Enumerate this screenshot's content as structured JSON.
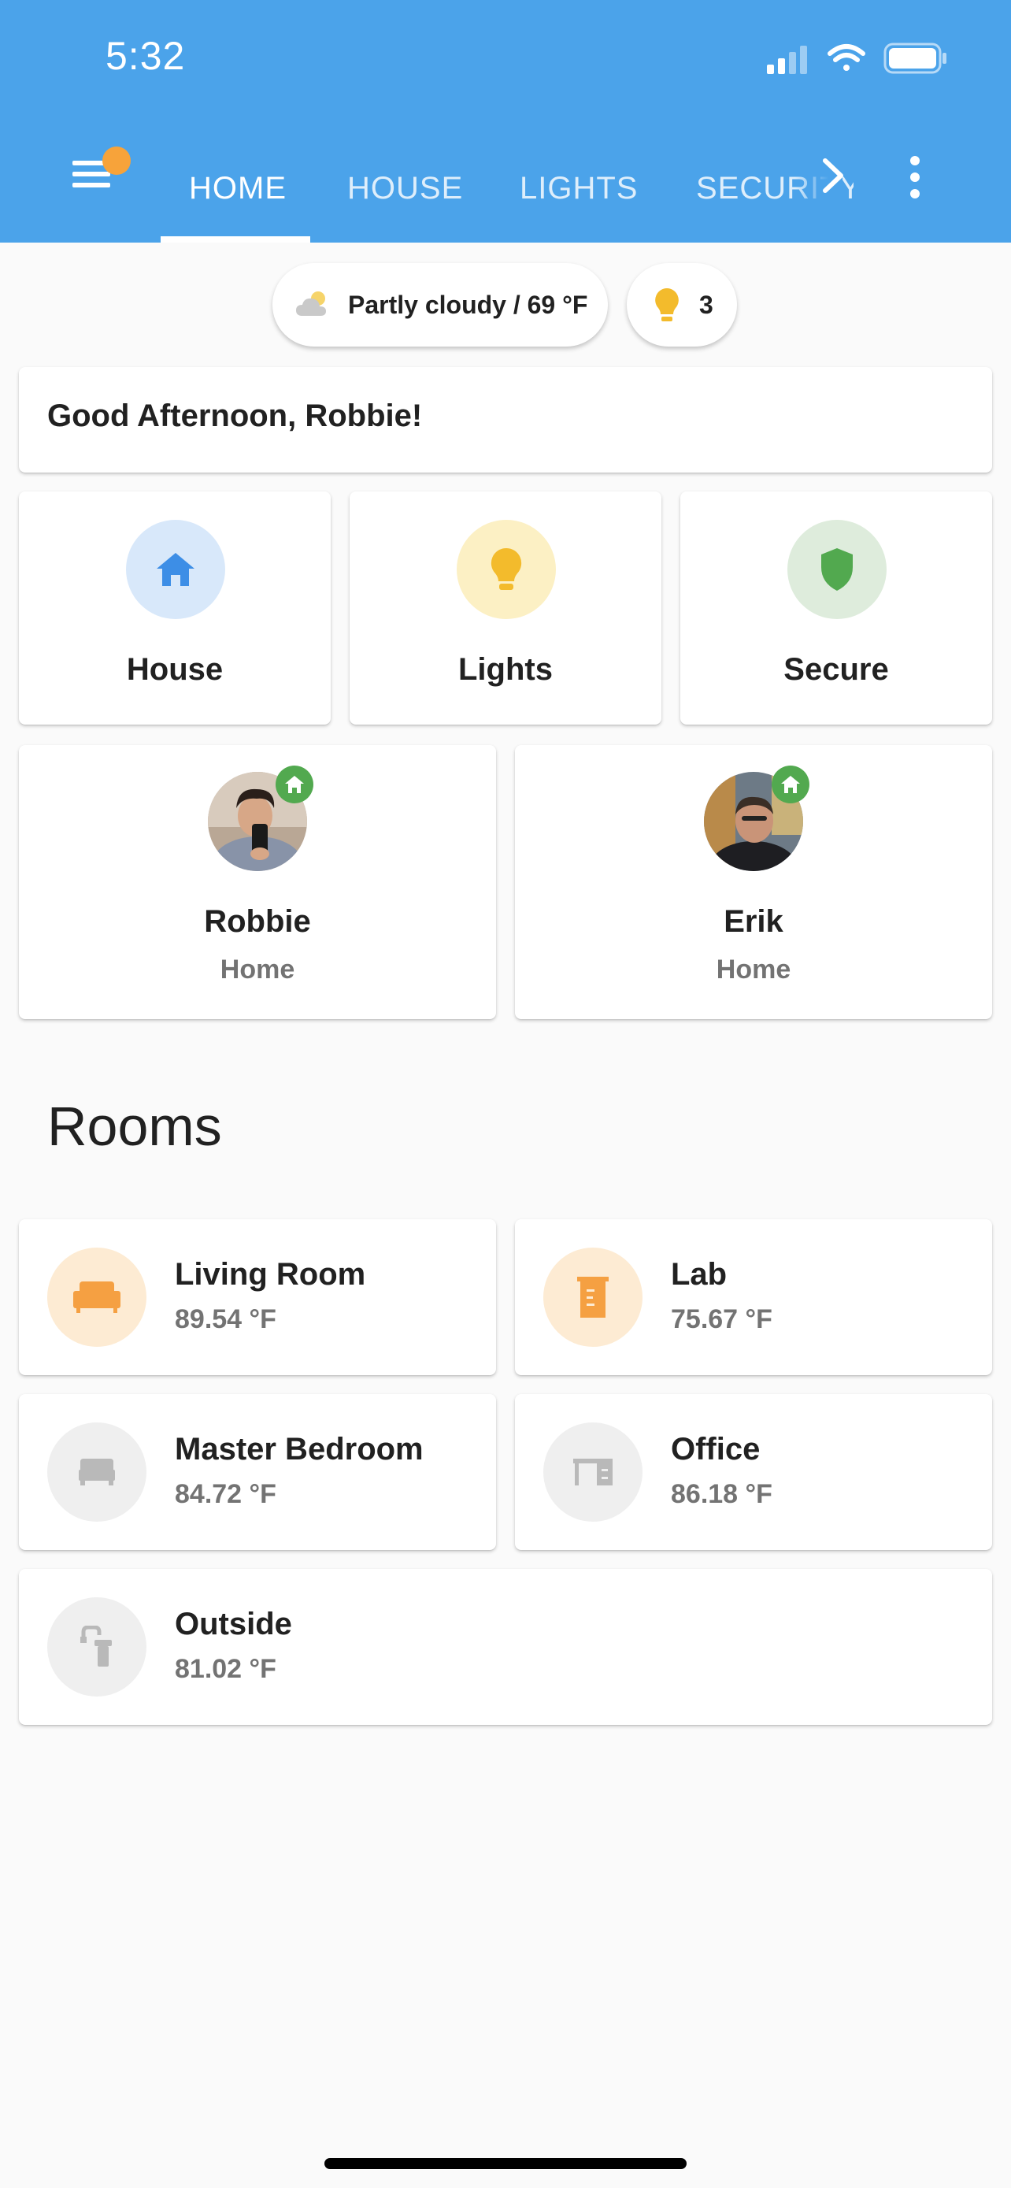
{
  "status_bar": {
    "time": "5:32"
  },
  "tabs": [
    {
      "label": "HOME",
      "active": true
    },
    {
      "label": "HOUSE",
      "active": false
    },
    {
      "label": "LIGHTS",
      "active": false
    },
    {
      "label": "SECURITY",
      "active": false
    }
  ],
  "badges": {
    "weather": {
      "icon": "partly-cloudy-icon",
      "text": "Partly cloudy / 69 °F"
    },
    "lights": {
      "icon": "lightbulb-icon",
      "count": "3"
    }
  },
  "greeting": "Good Afternoon, Robbie!",
  "areas": [
    {
      "label": "House",
      "icon": "home-icon",
      "circle_color": "#d8e8fa",
      "icon_color": "#3d8ee6"
    },
    {
      "label": "Lights",
      "icon": "lightbulb-icon",
      "circle_color": "#fcf0c4",
      "icon_color": "#f3bb2c"
    },
    {
      "label": "Secure",
      "icon": "shield-icon",
      "circle_color": "#deecdc",
      "icon_color": "#52a94f"
    }
  ],
  "people": [
    {
      "name": "Robbie",
      "status": "Home",
      "avatar": "avatar-photo"
    },
    {
      "name": "Erik",
      "status": "Home",
      "avatar": "avatar-photo"
    }
  ],
  "rooms_title": "Rooms",
  "rooms": [
    {
      "name": "Living Room",
      "temp": "89.54 °F",
      "icon": "sofa-icon",
      "circle_color": "#fdebd3",
      "icon_color": "#f5a042"
    },
    {
      "name": "Lab",
      "temp": "75.67 °F",
      "icon": "beaker-icon",
      "circle_color": "#fdebd3",
      "icon_color": "#f5a042"
    },
    {
      "name": "Master Bedroom",
      "temp": "84.72 °F",
      "icon": "bed-icon",
      "circle_color": "#efefef",
      "icon_color": "#b9b9b9"
    },
    {
      "name": "Office",
      "temp": "86.18 °F",
      "icon": "desk-icon",
      "circle_color": "#efefef",
      "icon_color": "#b9b9b9"
    },
    {
      "name": "Outside",
      "temp": "81.02 °F",
      "icon": "outdoor-faucet-icon",
      "circle_color": "#efefef",
      "icon_color": "#b9b9b9"
    }
  ]
}
